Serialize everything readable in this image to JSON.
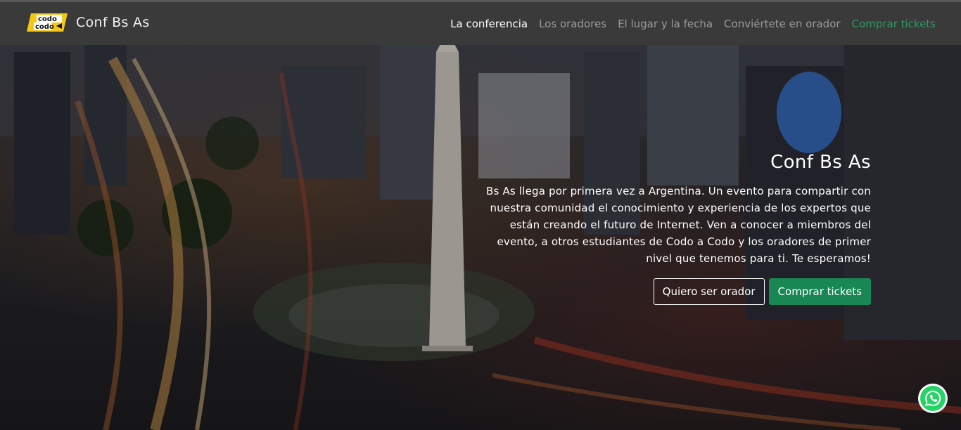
{
  "navbar": {
    "logo_line1": "codo",
    "logo_line2": "codo",
    "brand": "Conf Bs As",
    "items": [
      {
        "label": "La conferencia"
      },
      {
        "label": "Los oradores"
      },
      {
        "label": "El lugar y la fecha"
      },
      {
        "label": "Conviértete en orador"
      },
      {
        "label": "Comprar tickets"
      }
    ]
  },
  "hero": {
    "title": "Conf Bs As",
    "text": "Bs As llega por primera vez a Argentina. Un evento para compartir con nuestra comunidad el conocimiento y experiencia de los expertos que están creando el futuro de Internet. Ven a conocer a miembros del evento, a otros estudiantes de Codo a Codo y los oradores de primer nivel que tenemos para ti. Te esperamos!",
    "buttons": {
      "speaker": "Quiero ser orador",
      "tickets": "Comprar tickets"
    }
  },
  "colors": {
    "navbar_bg": "#3a3a3a",
    "accent_green": "#198754",
    "logo_yellow": "#f5c518"
  },
  "icons": {
    "whatsapp": "whatsapp-icon"
  }
}
